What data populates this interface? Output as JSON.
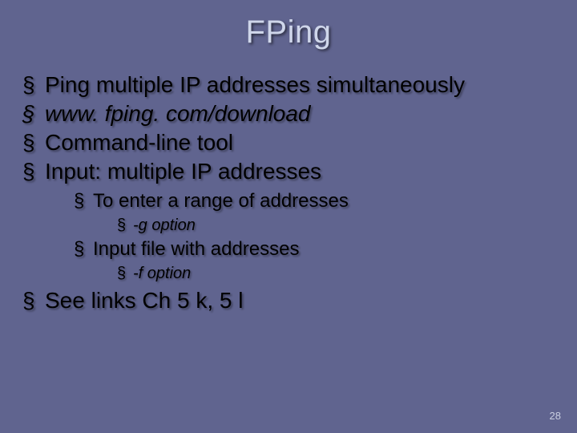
{
  "title": "FPing",
  "bullets": {
    "b1": "Ping multiple IP addresses simultaneously",
    "b2": "www. fping. com/download",
    "b3": "Command-line tool",
    "b4": "Input: multiple IP addresses",
    "b4_sub1": "To enter a range of addresses",
    "b4_sub1_sub1": "-g option",
    "b4_sub2": "Input file with addresses",
    "b4_sub2_sub1": "-f option",
    "b5": "See links Ch 5 k, 5 l"
  },
  "page_number": "28"
}
